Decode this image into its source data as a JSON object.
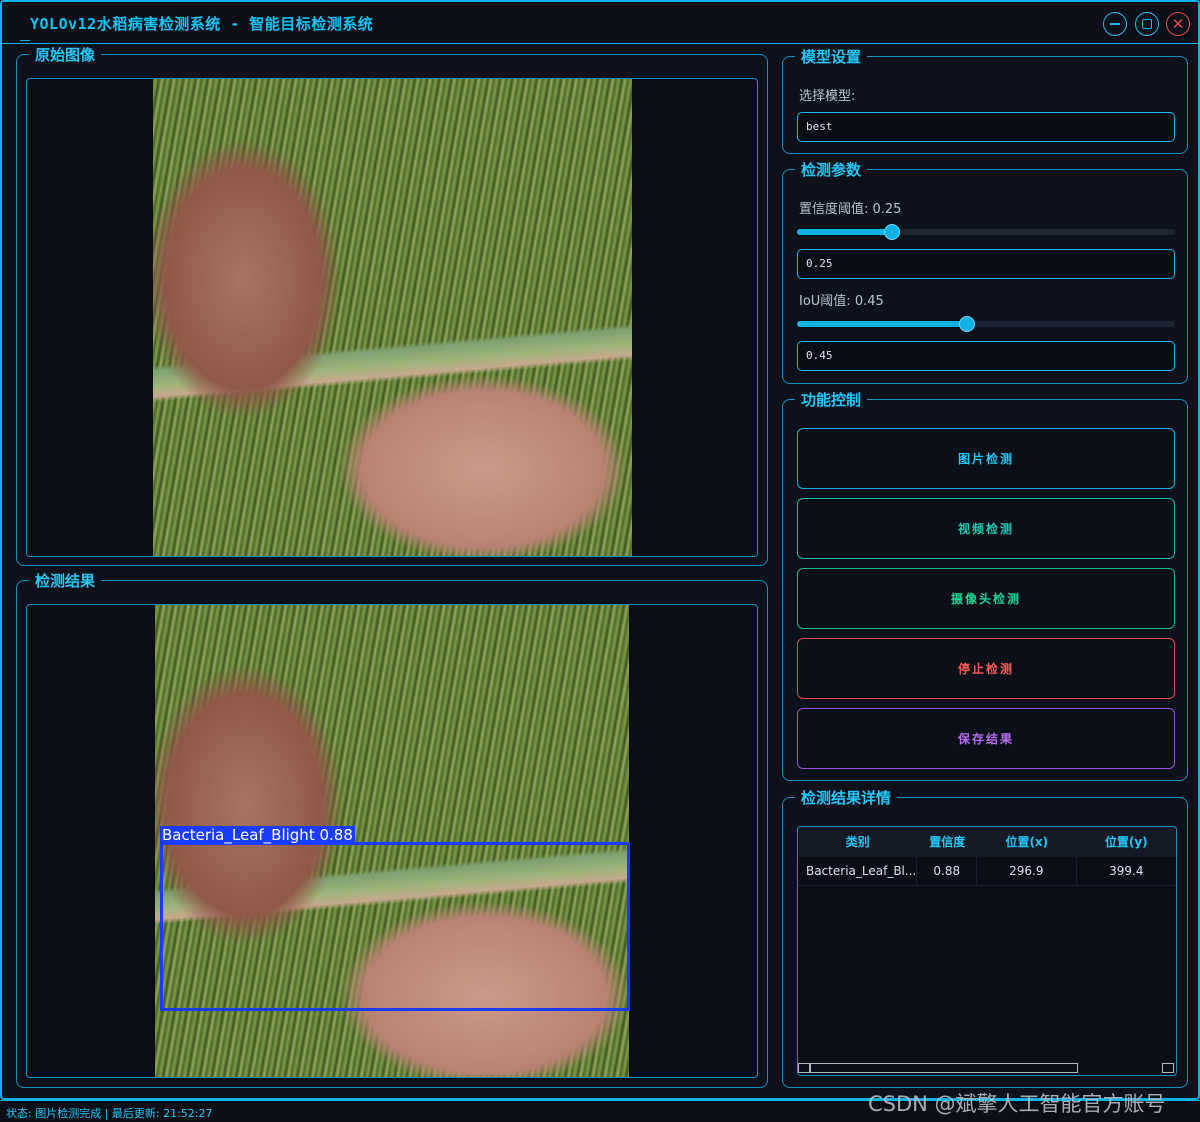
{
  "app": {
    "title": "YOLOv12水稻病害检测系统 - 智能目标检测系统"
  },
  "panels": {
    "original_image": {
      "title": "原始图像"
    },
    "detection_result": {
      "title": "检测结果",
      "box_label": "Bacteria_Leaf_Blight 0.88"
    }
  },
  "model_settings": {
    "title": "模型设置",
    "select_label": "选择模型:",
    "model_value": "best"
  },
  "detection_params": {
    "title": "检测参数",
    "confidence_label": "置信度阈值: 0.25",
    "confidence_value": "0.25",
    "confidence_level": 0.25,
    "iou_label": "IoU阈值: 0.45",
    "iou_value": "0.45",
    "iou_level": 0.45
  },
  "controls": {
    "title": "功能控制",
    "image_detect": "图片检测",
    "video_detect": "视频检测",
    "camera_detect": "摄像头检测",
    "stop_detect": "停止检测",
    "save_result": "保存结果"
  },
  "results_table": {
    "title": "检测结果详情",
    "headers": [
      "类别",
      "置信度",
      "位置(x)",
      "位置(y)"
    ],
    "rows": [
      [
        "Bacteria_Leaf_Bl...",
        "0.88",
        "296.9",
        "399.4"
      ]
    ]
  },
  "status": {
    "text": "状态: 图片检测完成 | 最后更新: 21:52:27"
  },
  "watermark": "CSDN @斌擎人工智能官方账号",
  "colors": {
    "accent": "#12c3f2",
    "border": "#148fbf",
    "close": "#ef4a4a",
    "detect_box": "#1a3cff",
    "stop": "#ff5a5a",
    "save": "#b56af0",
    "camera": "#1cd494"
  }
}
